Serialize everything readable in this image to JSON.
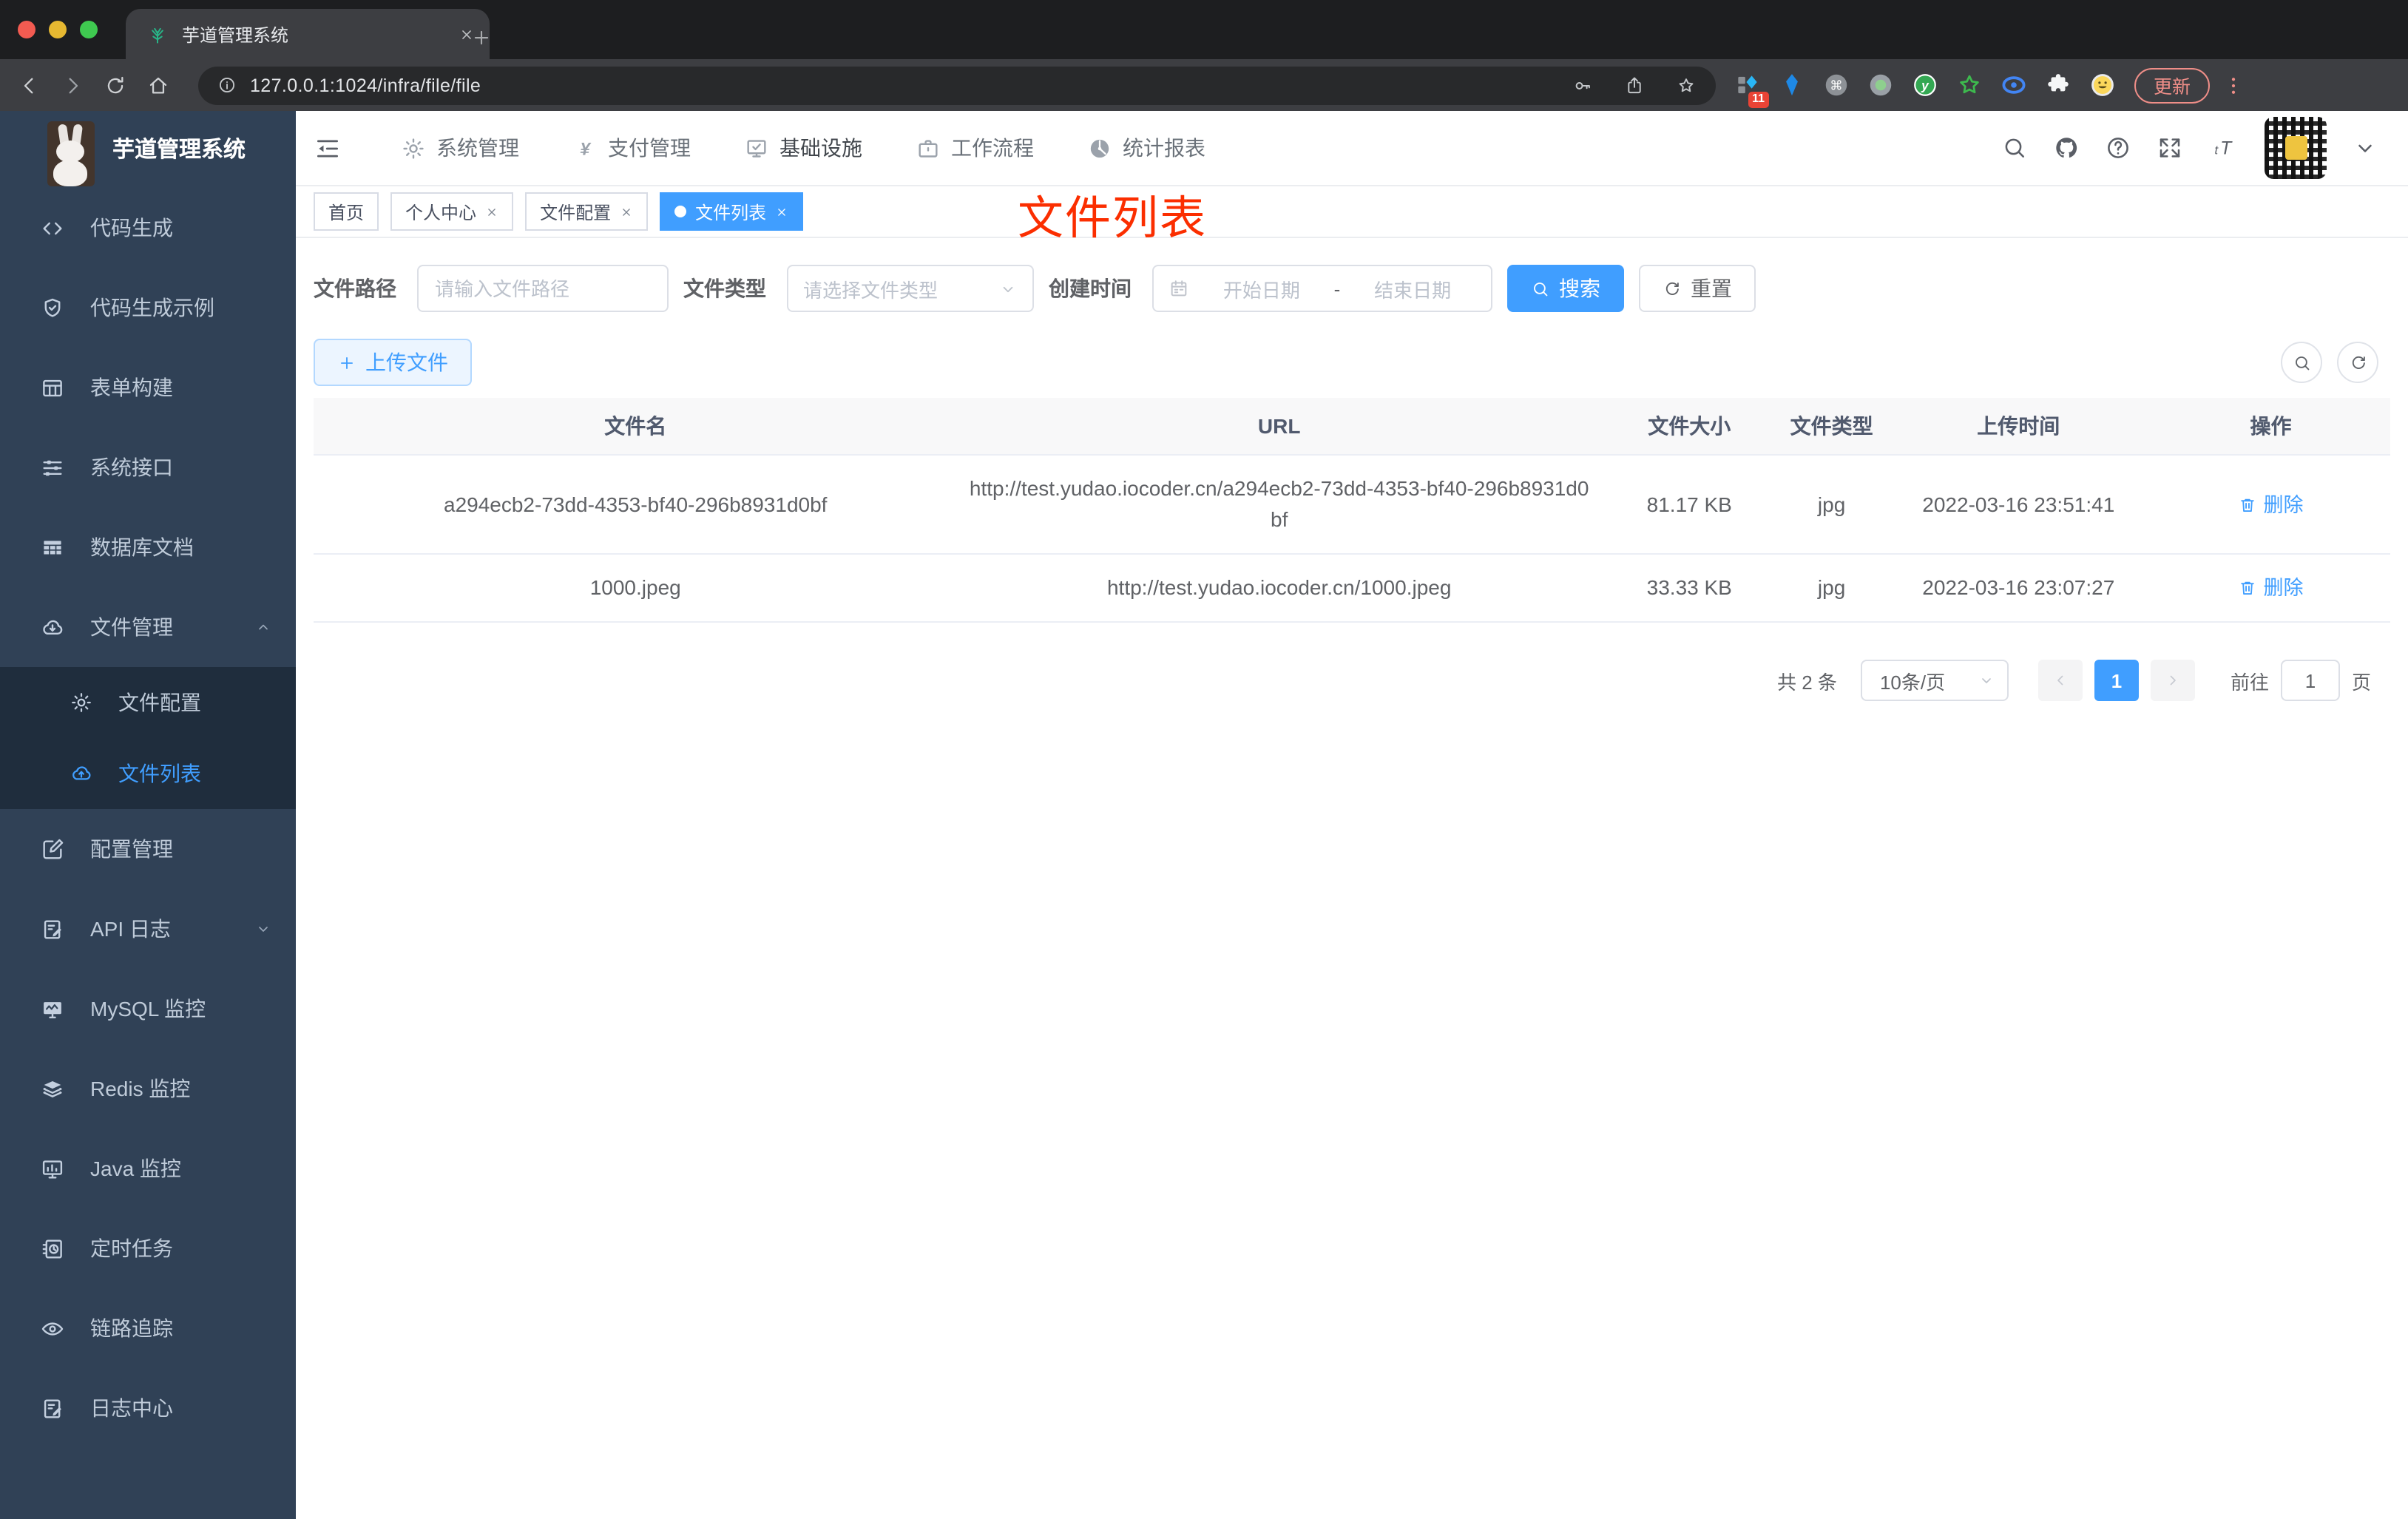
{
  "browser": {
    "tab_title": "芋道管理系统",
    "url": "127.0.0.1:1024/infra/file/file",
    "extension_badge": "11",
    "update_label": "更新"
  },
  "header": {
    "logo_title": "芋道管理系统",
    "nav": [
      {
        "label": "系统管理",
        "icon": "gear-icon"
      },
      {
        "label": "支付管理",
        "icon": "yen-icon"
      },
      {
        "label": "基础设施",
        "icon": "monitor-check-icon"
      },
      {
        "label": "工作流程",
        "icon": "briefcase-icon"
      },
      {
        "label": "统计报表",
        "icon": "dashboard-icon"
      }
    ]
  },
  "sidebar": {
    "items": [
      {
        "label": "代码生成",
        "icon": "code-icon"
      },
      {
        "label": "代码生成示例",
        "icon": "shield-check-icon"
      },
      {
        "label": "表单构建",
        "icon": "table-grid-icon"
      },
      {
        "label": "系统接口",
        "icon": "sliders-icon"
      },
      {
        "label": "数据库文档",
        "icon": "database-table-icon"
      },
      {
        "label": "文件管理",
        "icon": "cloud-download-icon",
        "expanded": true
      },
      {
        "label": "文件配置",
        "icon": "gear-icon",
        "sub": true
      },
      {
        "label": "文件列表",
        "icon": "cloud-upload-icon",
        "sub": true,
        "active": true
      },
      {
        "label": "配置管理",
        "icon": "edit-icon"
      },
      {
        "label": "API 日志",
        "icon": "edit-note-icon",
        "collapsed": true
      },
      {
        "label": "MySQL 监控",
        "icon": "monitor-wave-icon"
      },
      {
        "label": "Redis 监控",
        "icon": "layers-icon"
      },
      {
        "label": "Java 监控",
        "icon": "monitor-bars-icon"
      },
      {
        "label": "定时任务",
        "icon": "timer-icon"
      },
      {
        "label": "链路追踪",
        "icon": "eye-icon"
      },
      {
        "label": "日志中心",
        "icon": "edit-note-icon"
      }
    ]
  },
  "tags": [
    {
      "label": "首页",
      "closable": false,
      "active": false
    },
    {
      "label": "个人中心",
      "closable": true,
      "active": false
    },
    {
      "label": "文件配置",
      "closable": true,
      "active": false
    },
    {
      "label": "文件列表",
      "closable": true,
      "active": true
    }
  ],
  "annotation": {
    "text": "文件列表",
    "color": "#fb2e00"
  },
  "filters": {
    "path_label": "文件路径",
    "path_placeholder": "请输入文件路径",
    "type_label": "文件类型",
    "type_placeholder": "请选择文件类型",
    "time_label": "创建时间",
    "start_placeholder": "开始日期",
    "range_separator": "-",
    "end_placeholder": "结束日期",
    "search_label": "搜索",
    "reset_label": "重置"
  },
  "toolbar": {
    "upload_label": "上传文件"
  },
  "table": {
    "headers": [
      "文件名",
      "URL",
      "文件大小",
      "文件类型",
      "上传时间",
      "操作"
    ],
    "rows": [
      {
        "name": "a294ecb2-73dd-4353-bf40-296b8931d0bf",
        "url": "http://test.yudao.iocoder.cn/a294ecb2-73dd-4353-bf40-296b8931d0bf",
        "size": "81.17 KB",
        "type": "jpg",
        "time": "2022-03-16 23:51:41",
        "action": "删除"
      },
      {
        "name": "1000.jpeg",
        "url": "http://test.yudao.iocoder.cn/1000.jpeg",
        "size": "33.33 KB",
        "type": "jpg",
        "time": "2022-03-16 23:07:27",
        "action": "删除"
      }
    ]
  },
  "pagination": {
    "total": "共 2 条",
    "page_size": "10条/页",
    "current_page": "1",
    "goto_label": "前往",
    "goto_value": "1",
    "unit_label": "页"
  },
  "colors": {
    "accent": "#409eff",
    "sidebar_bg": "#304156",
    "submenu_bg": "#1f2d3d",
    "table_header_bg": "#f8f8f9",
    "annotation_red": "#fb2e00"
  }
}
